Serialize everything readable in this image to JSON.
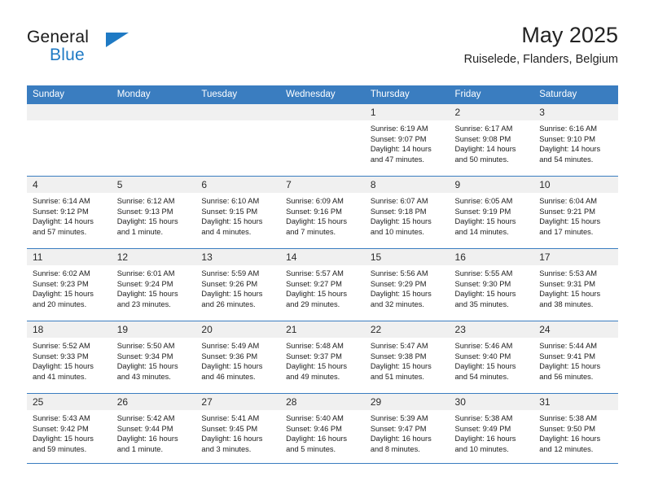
{
  "brand": {
    "name_top": "General",
    "name_bottom": "Blue",
    "flag_icon": "blue-triangle-flag-icon",
    "accent_color": "#1f7ac4"
  },
  "header": {
    "title": "May 2025",
    "location": "Ruiselede, Flanders, Belgium"
  },
  "theme": {
    "header_row_color": "#3a7dc0",
    "daynum_band_color": "#f0f0f0",
    "text_color": "#1c1c1c"
  },
  "weekday_headers": [
    "Sunday",
    "Monday",
    "Tuesday",
    "Wednesday",
    "Thursday",
    "Friday",
    "Saturday"
  ],
  "weeks": [
    [
      {
        "day": "",
        "empty": true,
        "sunrise": "",
        "sunset": "",
        "daylight_1": "",
        "daylight_2": ""
      },
      {
        "day": "",
        "empty": true,
        "sunrise": "",
        "sunset": "",
        "daylight_1": "",
        "daylight_2": ""
      },
      {
        "day": "",
        "empty": true,
        "sunrise": "",
        "sunset": "",
        "daylight_1": "",
        "daylight_2": ""
      },
      {
        "day": "",
        "empty": true,
        "sunrise": "",
        "sunset": "",
        "daylight_1": "",
        "daylight_2": ""
      },
      {
        "day": "1",
        "empty": false,
        "sunrise": "Sunrise: 6:19 AM",
        "sunset": "Sunset: 9:07 PM",
        "daylight_1": "Daylight: 14 hours",
        "daylight_2": "and 47 minutes."
      },
      {
        "day": "2",
        "empty": false,
        "sunrise": "Sunrise: 6:17 AM",
        "sunset": "Sunset: 9:08 PM",
        "daylight_1": "Daylight: 14 hours",
        "daylight_2": "and 50 minutes."
      },
      {
        "day": "3",
        "empty": false,
        "sunrise": "Sunrise: 6:16 AM",
        "sunset": "Sunset: 9:10 PM",
        "daylight_1": "Daylight: 14 hours",
        "daylight_2": "and 54 minutes."
      }
    ],
    [
      {
        "day": "4",
        "empty": false,
        "sunrise": "Sunrise: 6:14 AM",
        "sunset": "Sunset: 9:12 PM",
        "daylight_1": "Daylight: 14 hours",
        "daylight_2": "and 57 minutes."
      },
      {
        "day": "5",
        "empty": false,
        "sunrise": "Sunrise: 6:12 AM",
        "sunset": "Sunset: 9:13 PM",
        "daylight_1": "Daylight: 15 hours",
        "daylight_2": "and 1 minute."
      },
      {
        "day": "6",
        "empty": false,
        "sunrise": "Sunrise: 6:10 AM",
        "sunset": "Sunset: 9:15 PM",
        "daylight_1": "Daylight: 15 hours",
        "daylight_2": "and 4 minutes."
      },
      {
        "day": "7",
        "empty": false,
        "sunrise": "Sunrise: 6:09 AM",
        "sunset": "Sunset: 9:16 PM",
        "daylight_1": "Daylight: 15 hours",
        "daylight_2": "and 7 minutes."
      },
      {
        "day": "8",
        "empty": false,
        "sunrise": "Sunrise: 6:07 AM",
        "sunset": "Sunset: 9:18 PM",
        "daylight_1": "Daylight: 15 hours",
        "daylight_2": "and 10 minutes."
      },
      {
        "day": "9",
        "empty": false,
        "sunrise": "Sunrise: 6:05 AM",
        "sunset": "Sunset: 9:19 PM",
        "daylight_1": "Daylight: 15 hours",
        "daylight_2": "and 14 minutes."
      },
      {
        "day": "10",
        "empty": false,
        "sunrise": "Sunrise: 6:04 AM",
        "sunset": "Sunset: 9:21 PM",
        "daylight_1": "Daylight: 15 hours",
        "daylight_2": "and 17 minutes."
      }
    ],
    [
      {
        "day": "11",
        "empty": false,
        "sunrise": "Sunrise: 6:02 AM",
        "sunset": "Sunset: 9:23 PM",
        "daylight_1": "Daylight: 15 hours",
        "daylight_2": "and 20 minutes."
      },
      {
        "day": "12",
        "empty": false,
        "sunrise": "Sunrise: 6:01 AM",
        "sunset": "Sunset: 9:24 PM",
        "daylight_1": "Daylight: 15 hours",
        "daylight_2": "and 23 minutes."
      },
      {
        "day": "13",
        "empty": false,
        "sunrise": "Sunrise: 5:59 AM",
        "sunset": "Sunset: 9:26 PM",
        "daylight_1": "Daylight: 15 hours",
        "daylight_2": "and 26 minutes."
      },
      {
        "day": "14",
        "empty": false,
        "sunrise": "Sunrise: 5:57 AM",
        "sunset": "Sunset: 9:27 PM",
        "daylight_1": "Daylight: 15 hours",
        "daylight_2": "and 29 minutes."
      },
      {
        "day": "15",
        "empty": false,
        "sunrise": "Sunrise: 5:56 AM",
        "sunset": "Sunset: 9:29 PM",
        "daylight_1": "Daylight: 15 hours",
        "daylight_2": "and 32 minutes."
      },
      {
        "day": "16",
        "empty": false,
        "sunrise": "Sunrise: 5:55 AM",
        "sunset": "Sunset: 9:30 PM",
        "daylight_1": "Daylight: 15 hours",
        "daylight_2": "and 35 minutes."
      },
      {
        "day": "17",
        "empty": false,
        "sunrise": "Sunrise: 5:53 AM",
        "sunset": "Sunset: 9:31 PM",
        "daylight_1": "Daylight: 15 hours",
        "daylight_2": "and 38 minutes."
      }
    ],
    [
      {
        "day": "18",
        "empty": false,
        "sunrise": "Sunrise: 5:52 AM",
        "sunset": "Sunset: 9:33 PM",
        "daylight_1": "Daylight: 15 hours",
        "daylight_2": "and 41 minutes."
      },
      {
        "day": "19",
        "empty": false,
        "sunrise": "Sunrise: 5:50 AM",
        "sunset": "Sunset: 9:34 PM",
        "daylight_1": "Daylight: 15 hours",
        "daylight_2": "and 43 minutes."
      },
      {
        "day": "20",
        "empty": false,
        "sunrise": "Sunrise: 5:49 AM",
        "sunset": "Sunset: 9:36 PM",
        "daylight_1": "Daylight: 15 hours",
        "daylight_2": "and 46 minutes."
      },
      {
        "day": "21",
        "empty": false,
        "sunrise": "Sunrise: 5:48 AM",
        "sunset": "Sunset: 9:37 PM",
        "daylight_1": "Daylight: 15 hours",
        "daylight_2": "and 49 minutes."
      },
      {
        "day": "22",
        "empty": false,
        "sunrise": "Sunrise: 5:47 AM",
        "sunset": "Sunset: 9:38 PM",
        "daylight_1": "Daylight: 15 hours",
        "daylight_2": "and 51 minutes."
      },
      {
        "day": "23",
        "empty": false,
        "sunrise": "Sunrise: 5:46 AM",
        "sunset": "Sunset: 9:40 PM",
        "daylight_1": "Daylight: 15 hours",
        "daylight_2": "and 54 minutes."
      },
      {
        "day": "24",
        "empty": false,
        "sunrise": "Sunrise: 5:44 AM",
        "sunset": "Sunset: 9:41 PM",
        "daylight_1": "Daylight: 15 hours",
        "daylight_2": "and 56 minutes."
      }
    ],
    [
      {
        "day": "25",
        "empty": false,
        "sunrise": "Sunrise: 5:43 AM",
        "sunset": "Sunset: 9:42 PM",
        "daylight_1": "Daylight: 15 hours",
        "daylight_2": "and 59 minutes."
      },
      {
        "day": "26",
        "empty": false,
        "sunrise": "Sunrise: 5:42 AM",
        "sunset": "Sunset: 9:44 PM",
        "daylight_1": "Daylight: 16 hours",
        "daylight_2": "and 1 minute."
      },
      {
        "day": "27",
        "empty": false,
        "sunrise": "Sunrise: 5:41 AM",
        "sunset": "Sunset: 9:45 PM",
        "daylight_1": "Daylight: 16 hours",
        "daylight_2": "and 3 minutes."
      },
      {
        "day": "28",
        "empty": false,
        "sunrise": "Sunrise: 5:40 AM",
        "sunset": "Sunset: 9:46 PM",
        "daylight_1": "Daylight: 16 hours",
        "daylight_2": "and 5 minutes."
      },
      {
        "day": "29",
        "empty": false,
        "sunrise": "Sunrise: 5:39 AM",
        "sunset": "Sunset: 9:47 PM",
        "daylight_1": "Daylight: 16 hours",
        "daylight_2": "and 8 minutes."
      },
      {
        "day": "30",
        "empty": false,
        "sunrise": "Sunrise: 5:38 AM",
        "sunset": "Sunset: 9:49 PM",
        "daylight_1": "Daylight: 16 hours",
        "daylight_2": "and 10 minutes."
      },
      {
        "day": "31",
        "empty": false,
        "sunrise": "Sunrise: 5:38 AM",
        "sunset": "Sunset: 9:50 PM",
        "daylight_1": "Daylight: 16 hours",
        "daylight_2": "and 12 minutes."
      }
    ]
  ]
}
